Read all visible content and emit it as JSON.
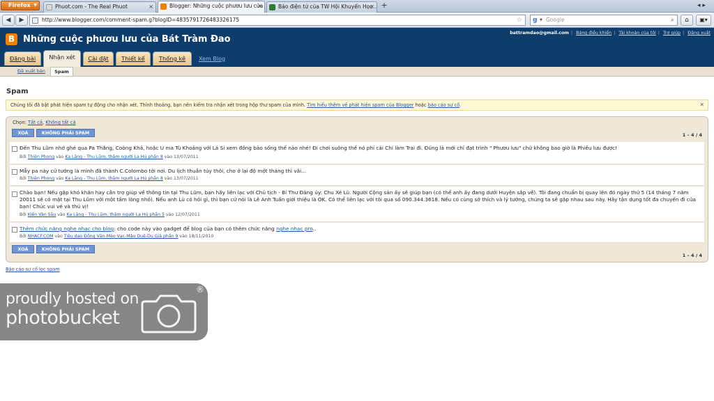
{
  "browser": {
    "menu_label": "Firefox",
    "tabs": [
      {
        "label": "Phuot.com - The Real Phuot",
        "icon_color": "#d9d9d9",
        "active": false
      },
      {
        "label": "Blogger: Những cuộc phươu lưu của ...",
        "icon_color": "#f57d00",
        "active": true
      },
      {
        "label": "Báo điện tử của TW Hội Khuyến Học ...",
        "icon_color": "#2e7d32",
        "active": false
      }
    ],
    "new_tab_glyph": "+",
    "url": "http://www.blogger.com/comment-spam.g?blogID=4835791726483326175",
    "search_placeholder": "Google"
  },
  "header": {
    "logo_letter": "B",
    "title": "Những cuộc phươu lưu của Bát Tràm Đao",
    "email": "battramdao@gmail.com",
    "links": [
      "Bảng điều khiển",
      "Tài khoản của tôi",
      "Trợ giúp",
      "Đăng xuất"
    ]
  },
  "main_tabs": [
    "Đăng bài",
    "Nhận xét",
    "Cài đặt",
    "Thiết kế",
    "Thống kê"
  ],
  "view_blog_label": "Xem Blog",
  "subnav": {
    "published": "Đã xuất bản",
    "spam": "Spam"
  },
  "page_title": "Spam",
  "notice": {
    "text": "Chúng tôi đã bật phát hiện spam tự động cho nhận xét. Thỉnh thoảng, bạn nên kiểm tra nhận xét trong hộp thư spam của mình.",
    "link1": "Tìm hiểu thêm về phát hiện spam của Blogger",
    "or": "hoặc",
    "link2": "báo cáo sự cố",
    "end": "."
  },
  "toolbar": {
    "select_label": "Chọn:",
    "select_all": "Tất cả",
    "select_none": "Không tất cả",
    "delete_button": "XOÁ",
    "not_spam_button": "KHÔNG PHẢI SPAM",
    "count": "1 – 4 / 4"
  },
  "comments": [
    {
      "text": "Đến Thu Lũm nhớ ghé qua Pa Thắng, Coòng Khả, hoặc U ma Tù Khoảng với Lá Si xem đồng bào sống thế nào nhé! Đi chơi suông thế nó phí cái Chí làm Trai đi. Đúng là mới chỉ đạt trình \" Phươu lưu\" chứ không bao giờ là Phiêu lưu được!",
      "by": "Bởi",
      "author": "Thiên Phong",
      "at": "vào",
      "post": "Ka Lăng - Thu Lũm, thăm người La Hủ phần 8",
      "date_prefix": "vào",
      "date": "13/07/2011"
    },
    {
      "text": "Mẫy pa này cứ tưởng là mình đã thành C.Colombo tới nơi. Du lịch thuần túy thôi, cho ở lại độ một tháng thì vãi...",
      "by": "Bởi",
      "author": "Thiên Phong",
      "at": "vào",
      "post": "Ka Lăng - Thu Lũm, thăm người La Hủ phần 8",
      "date_prefix": "vào",
      "date": "13/07/2011"
    },
    {
      "text": "Chào bạn! Nếu gặp khó khăn hay cần trợ giúp về thông tin tại Thu Lũm, bạn hãy liên lạc với Chủ tịch - Bí Thư Đảng ủy: Chu Xé Lù. Người Cộng sản ấy sẽ giúp bạn (có thể anh ấy đang dưới Huyện sắp về). Tôi đang chuẩn bị quay lên đó ngày thứ 5 (14 tháng 7 năm 20011 sẽ có mặt tại Thu Lũm với một tấm lòng nhỏ). Nếu anh Lù có hỏi gì, thì bạn cứ nói là Lê Anh Tuấn giới thiệu là OK. Có thể liên lạc với tôi qua số 090.344.3618. Nếu có cùng sở thích và lý tưởng, chúng ta sẽ gặp nhau sau này. Hãy tận dụng tốt đa chuyến đi của bạn! Chúc vui vẻ và thú vị!",
      "by": "Bởi",
      "author": "Kiến Vàn Sầu",
      "at": "vào",
      "post": "Ka Lăng - Thu Lũm, thăm người La Hủ phần 5",
      "date_prefix": "vào",
      "date": "12/07/2011"
    },
    {
      "text_link1": "Thêm chức năng nghe nhạc cho blog",
      "text_mid": ": cho code này vào gadget để blog của bạn có thêm chức năng",
      "text_link2": "nghe nhạc pro",
      "text_end": "..",
      "by": "Bởi",
      "author": "NHACF.COM",
      "at": "vào",
      "post": "Tiêu dao Đồng Văn-Mèo Vạc-Mậu Duệ-Du Già phần 9",
      "date_prefix": "vào",
      "date": "18/11/2010"
    }
  ],
  "filter_link": "Báo cáo sự cố lọc spam",
  "watermark": {
    "line1": "proudly hosted on",
    "line2": "photobucket",
    "reg": "®"
  }
}
